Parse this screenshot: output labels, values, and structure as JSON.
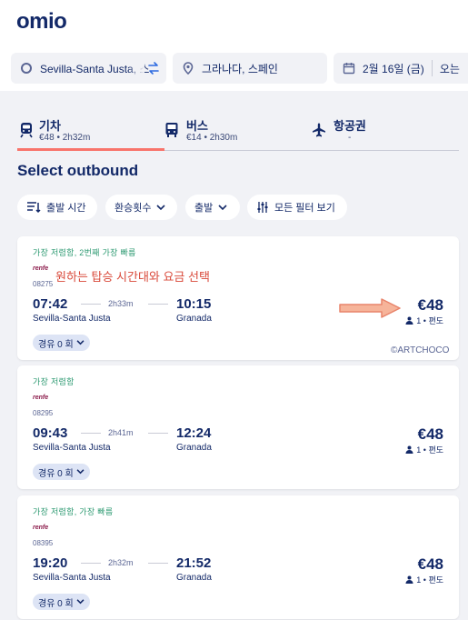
{
  "app": {
    "logo": "omio"
  },
  "search": {
    "origin": "Sevilla-Santa Justa, 스",
    "destination": "그라나다, 스페인",
    "date": "2월 16일 (금)",
    "return": "오는"
  },
  "tabs": [
    {
      "label": "기차",
      "sub": "€48 • 2h32m"
    },
    {
      "label": "버스",
      "sub": "€14 • 2h30m"
    },
    {
      "label": "항공권",
      "sub": "-"
    }
  ],
  "section_title": "Select outbound",
  "filters": [
    "출발 시간",
    "환승횟수",
    "출발",
    "모든 필터 보기"
  ],
  "results": [
    {
      "tag": "가장 저렴함,  2번째 가장 빠름",
      "brand": "renfe",
      "train_no": "08275",
      "dep_time": "07:42",
      "dep_station": "Sevilla-Santa Justa",
      "duration": "2h33m",
      "arr_time": "10:15",
      "arr_station": "Granada",
      "price": "€48",
      "pax": "1 • 편도",
      "stops": "경유 0 회"
    },
    {
      "tag": "가장 저렴함",
      "brand": "renfe",
      "train_no": "08295",
      "dep_time": "09:43",
      "dep_station": "Sevilla-Santa Justa",
      "duration": "2h41m",
      "arr_time": "12:24",
      "arr_station": "Granada",
      "price": "€48",
      "pax": "1 • 편도",
      "stops": "경유 0 회"
    },
    {
      "tag": "가장 저렴함,  가장 빠름",
      "brand": "renfe",
      "train_no": "08395",
      "dep_time": "19:20",
      "dep_station": "Sevilla-Santa Justa",
      "duration": "2h32m",
      "arr_time": "21:52",
      "arr_station": "Granada",
      "price": "€48",
      "pax": "1 • 편도",
      "stops": "경유 0 회"
    }
  ],
  "annotation": "원하는 탑승 시간대와 요금 선택",
  "watermark": "©ARTCHOCO",
  "colors": {
    "brand_navy": "#132968",
    "accent_coral": "#f8746b",
    "tag_green": "#2e9a72",
    "annotation_red": "#d9493a"
  }
}
